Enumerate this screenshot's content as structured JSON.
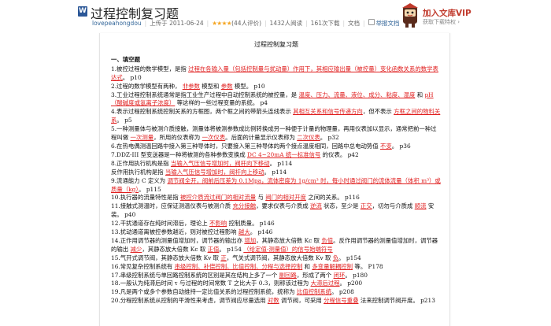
{
  "header": {
    "doc_icon": "W",
    "title": "过程控制复习题",
    "user": "lovepeahongdou",
    "upload_date": "上传于  2011-06-24",
    "stars": "★★★★",
    "rating": "(44人评价)",
    "reads": "1432人阅读",
    "downloads": "161次下载",
    "icon_report": "report-icon",
    "report": "举报文档",
    "doc_info": "文档",
    "vip_title": "加入文库VIP",
    "vip_sub": "获取下载特权 ›"
  },
  "document": {
    "page_title": "过程控制复习题",
    "section_title": "一、填空题",
    "questions": [
      {
        "id": "q1",
        "parts": [
          {
            "t": "1.被控过程的数学模型，是指  "
          },
          {
            "a": "过程在各输入量（包括控制量与扰动量）作用下，其相应输出量（被控量）变化函数关系的数学表达式"
          },
          {
            "t": "。    p10"
          }
        ]
      },
      {
        "id": "q2",
        "parts": [
          {
            "t": "2.过程的数学模型有两种，  "
          },
          {
            "a": "非参数"
          },
          {
            "t": "  模型和  "
          },
          {
            "a": "参数"
          },
          {
            "t": "  模型。  p10"
          }
        ]
      },
      {
        "id": "q3",
        "parts": [
          {
            "t": "3.工业过程控制系统通常是指工业生产过程中自动控制系统的被控量，是  "
          },
          {
            "a": "温度、压力、流量、液位、成分、粘度、湿度"
          },
          {
            "t": "  和  "
          },
          {
            "a": "pH（酸碱度或氢离子浓度）"
          },
          {
            "t": "  等这样的一些过程变量的系统。   p4"
          }
        ]
      },
      {
        "id": "q4",
        "parts": [
          {
            "t": "4.表示过程控制系统控制关系的方框图，两个框之间的带箭头连线表示  "
          },
          {
            "a": "其相互关系和信号传递方向"
          },
          {
            "t": "，但不表示  "
          },
          {
            "a": "方框之间的物料关系"
          },
          {
            "t": "。   p5"
          }
        ]
      },
      {
        "id": "q5",
        "parts": [
          {
            "t": "5.一种测量体与被测介质接触，测量体将被测参数成比例转换成另一种便于计量的物理量，再用仪表加以显示，通常把前一种过程叫做  "
          },
          {
            "a": "一次测量"
          },
          {
            "t": "，所用的仪表称为  "
          },
          {
            "a": "一次仪表"
          },
          {
            "t": "。后面的计量显示仪表称为  "
          },
          {
            "a": "二次仪表"
          },
          {
            "t": "。  p32"
          }
        ]
      },
      {
        "id": "q6",
        "parts": [
          {
            "t": "6.在热电偶测温回路中接入第三种导体时，只要接入第三种导体的两个接点温度相同，回路中总电动势值  "
          },
          {
            "a": "不变"
          },
          {
            "t": "。   p36"
          }
        ]
      },
      {
        "id": "q7",
        "parts": [
          {
            "t": "7.DDZ-III 型变送器是一种将被测的各种参数变换成  "
          },
          {
            "a": "DC 4~20mA 统一标准信号"
          },
          {
            "t": "  的仪表。   p42"
          }
        ]
      },
      {
        "id": "q8",
        "parts": [
          {
            "t": "8.正作用执行机构是指  "
          },
          {
            "a": "当输入气压信号增加时，阀杆向下移动"
          },
          {
            "t": "。   p114"
          },
          {
            "br": true
          },
          {
            "t": "   反作用执行机构是指  "
          },
          {
            "a": "当输入气压信号增加时，阀杆向上移动"
          },
          {
            "t": "。   p114"
          }
        ]
      },
      {
        "id": "q9",
        "parts": [
          {
            "t": "9.流通能力 C 定义为  "
          },
          {
            "a": "调节阀全开，阀前后压差为 0.1Mpa，流体密度为 1g/cm³ 时，每小时通过阀门的流体流量（体积 m³）或质量（kg）"
          },
          {
            "t": "。   p115"
          }
        ]
      },
      {
        "id": "q10",
        "parts": [
          {
            "t": "10.执行器的流量特性是指  "
          },
          {
            "a": "被控介质流过阀门的相对流量"
          },
          {
            "t": "  与  "
          },
          {
            "a": "阀门的相对开度"
          },
          {
            "t": "  之间的关系。    p116"
          }
        ]
      },
      {
        "id": "q11",
        "parts": [
          {
            "t": "11.接触式测温时，应保证测温仪表与被测介质  "
          },
          {
            "a": "充分接触"
          },
          {
            "t": "，要求仪表与介质成  "
          },
          {
            "a": "逆流"
          },
          {
            "t": "  状态，至少是  "
          },
          {
            "a": "正交"
          },
          {
            "t": "，切勿与介质成  "
          },
          {
            "a": "顺流"
          },
          {
            "t": "  安装。   p40"
          }
        ]
      },
      {
        "id": "q12",
        "parts": [
          {
            "t": "12.干扰通道存在纯时间滞后，理论上  "
          },
          {
            "a": "不影响"
          },
          {
            "t": "  控制质量。    p146"
          }
        ]
      },
      {
        "id": "q13",
        "parts": [
          {
            "t": "13.扰动通道离被控参数越近，则对被控过程影响  "
          },
          {
            "a": "越大"
          },
          {
            "t": "。   p146"
          }
        ]
      },
      {
        "id": "q14",
        "parts": [
          {
            "t": "14.正作用调节器的测量值增加时，调节器的输出亦  "
          },
          {
            "a": "增加"
          },
          {
            "t": "，其静态放大倍数 Kc 取  "
          },
          {
            "a": "负值"
          },
          {
            "t": "。反作用调节器的测量值增加时，调节器的输出  "
          },
          {
            "a": "减少"
          },
          {
            "t": "，其静态放大倍数 Kc 取  "
          },
          {
            "a": "正值"
          },
          {
            "t": "。   p154  "
          },
          {
            "a": "（给定值-测量值）的信号始端符号"
          }
        ]
      },
      {
        "id": "q15",
        "parts": [
          {
            "t": "15.气开式调节阀，其静态放大倍数 Kv 取  "
          },
          {
            "a": "正"
          },
          {
            "t": "，气关式调节阀，其静态放大倍数 Kv 取  "
          },
          {
            "a": "负"
          },
          {
            "t": "。   p154"
          }
        ]
      },
      {
        "id": "q16",
        "parts": [
          {
            "t": "16.常见复杂控制系统有  "
          },
          {
            "a": "串级控制、补偿控制、比值控制、分程与选择控制"
          },
          {
            "t": "  和  "
          },
          {
            "a": "多变量解耦控制"
          },
          {
            "t": "  等。   P178"
          }
        ]
      },
      {
        "id": "q17",
        "parts": [
          {
            "t": "17.串级控制系统与单回路控制系统的区别是其在结构上多了一个  "
          },
          {
            "a": "副回路"
          },
          {
            "t": "，形成了两个  "
          },
          {
            "a": "闭环"
          },
          {
            "t": "。   p180"
          }
        ]
      },
      {
        "id": "q18",
        "parts": [
          {
            "t": "18.一般认为纯滞后时间 τ 与过程的时间常数 T 之比大于 0.3，则称该过程为  "
          },
          {
            "a": "大滞后过程"
          },
          {
            "t": "。   p200"
          }
        ]
      },
      {
        "id": "q19",
        "parts": [
          {
            "t": "19.凡是两个或多个参数自动维持一定比值关系的过程控制系统，统称为  "
          },
          {
            "a": "比值控制系统"
          },
          {
            "t": "。   p208"
          }
        ]
      },
      {
        "id": "q20",
        "parts": [
          {
            "t": "20.分程控制系统从控制的平滑性来考虑，调节阀应尽量选用  "
          },
          {
            "a": "对数"
          },
          {
            "t": "  调节阀，可采用  "
          },
          {
            "a": "分程信号重叠"
          },
          {
            "t": "  法来控制调节阀开度。    p213"
          }
        ]
      }
    ]
  }
}
